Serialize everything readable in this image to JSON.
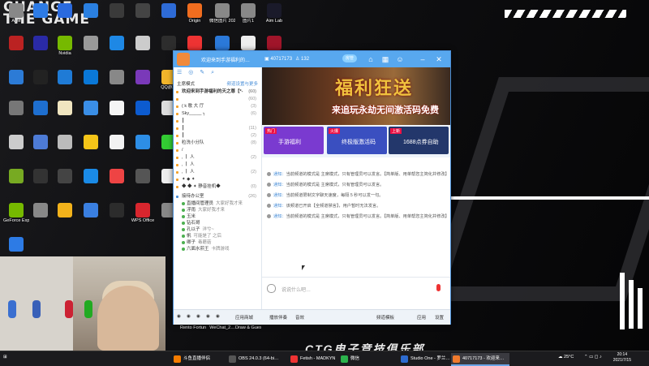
{
  "desktop": {
    "brand_text": "CHANGE THE GAME",
    "brand_bottom": "CTG电子竞技俱乐部",
    "icons": [
      {
        "label": "Ame",
        "color": "#888"
      },
      {
        "label": "",
        "color": "#2d7be5"
      },
      {
        "label": "",
        "color": "#2a6adf"
      },
      {
        "label": "",
        "color": "#2a7fe0"
      },
      {
        "label": "",
        "color": "#3a3a3a"
      },
      {
        "label": "",
        "color": "#444"
      },
      {
        "label": "",
        "color": "#2e6bd6"
      },
      {
        "label": "Origin",
        "color": "#f06d1f"
      },
      {
        "label": "微信图片 2021041…",
        "color": "#888"
      },
      {
        "label": "图片1",
        "color": "#888"
      },
      {
        "label": "Aim Lab",
        "color": "#1a1a2a"
      },
      {
        "label": "",
        "color": "#b22"
      },
      {
        "label": "",
        "color": "#2a2aa6"
      },
      {
        "label": "Nvidia",
        "color": "#76b900"
      },
      {
        "label": "",
        "color": "#999"
      },
      {
        "label": "",
        "color": "#1e88e5"
      },
      {
        "label": "",
        "color": "#ccc"
      },
      {
        "label": "",
        "color": "#2d2d2d"
      },
      {
        "label": "",
        "color": "#e33"
      },
      {
        "label": "",
        "color": "#2b79d9"
      },
      {
        "label": "",
        "color": "#eee"
      },
      {
        "label": "Extreme",
        "color": "#a0152a"
      },
      {
        "label": "",
        "color": "#2c7bd6"
      },
      {
        "label": "",
        "color": "#222"
      },
      {
        "label": "",
        "color": "#1f7bd6"
      },
      {
        "label": "",
        "color": "#0a78d7"
      },
      {
        "label": "",
        "color": "#888"
      },
      {
        "label": "",
        "color": "#7a39b9"
      },
      {
        "label": "QQ游戏",
        "color": "#f2b52b"
      },
      {
        "label": "Microsoft Edge",
        "color": "#1e86d4"
      },
      {
        "label": "",
        "color": "#0a0a0a"
      },
      {
        "label": "",
        "color": "#e6a50a"
      },
      {
        "label": "",
        "color": "#555"
      },
      {
        "label": "",
        "color": "#777"
      },
      {
        "label": "",
        "color": "#1e6fd0"
      },
      {
        "label": "",
        "color": "#f0e5c0"
      },
      {
        "label": "",
        "color": "#3a8ee6"
      },
      {
        "label": "",
        "color": "#f5f5f5"
      },
      {
        "label": "",
        "color": "#0c5bcf"
      },
      {
        "label": "",
        "color": "#ddd"
      },
      {
        "label": "",
        "color": "#e8b420"
      },
      {
        "label": "",
        "color": "#d23"
      },
      {
        "label": "QQ音乐",
        "color": "#31c27c"
      },
      {
        "label": "",
        "color": "#d94b2b"
      },
      {
        "label": "",
        "color": "#ccc"
      },
      {
        "label": "",
        "color": "#4d7bd6"
      },
      {
        "label": "",
        "color": "#bbb"
      },
      {
        "label": "",
        "color": "#f5c518"
      },
      {
        "label": "",
        "color": "#f2f2f2"
      },
      {
        "label": "",
        "color": "#2d8ee6"
      },
      {
        "label": "",
        "color": "#3c3"
      },
      {
        "label": "",
        "color": "#eee"
      },
      {
        "label": "Counter-Strike Global Off…",
        "color": "#e7a72b"
      },
      {
        "label": "",
        "color": "#eee"
      },
      {
        "label": "",
        "color": "#f0f0f0"
      },
      {
        "label": "",
        "color": "#7a2"
      },
      {
        "label": "",
        "color": "#333"
      },
      {
        "label": "",
        "color": "#444"
      },
      {
        "label": "",
        "color": "#1a8ae6"
      },
      {
        "label": "",
        "color": "#e44"
      },
      {
        "label": "",
        "color": "#555"
      },
      {
        "label": "",
        "color": "#eee"
      },
      {
        "label": "",
        "color": "#0f6ad1"
      },
      {
        "label": "CPUID CPU-Z",
        "color": "#4466aa"
      },
      {
        "label": "YY语音",
        "color": "#f4c430"
      },
      {
        "label": "",
        "color": "#888"
      },
      {
        "label": "GeForce Experience",
        "color": "#76b900"
      },
      {
        "label": "",
        "color": "#888"
      },
      {
        "label": "",
        "color": "#f2b21b"
      },
      {
        "label": "",
        "color": "#3a7fe0"
      },
      {
        "label": "",
        "color": "#2c2c2c"
      },
      {
        "label": "WPS Office",
        "color": "#d8262e"
      },
      {
        "label": "",
        "color": "#888"
      },
      {
        "label": "",
        "color": "#888"
      },
      {
        "label": "",
        "color": "#1f8ae6"
      },
      {
        "label": "",
        "color": "#1e78d7"
      },
      {
        "label": "",
        "color": "#fff"
      },
      {
        "label": "",
        "color": "#2d7be5"
      }
    ],
    "dock_labels": [
      "Rento Fortune -…",
      "WeChat_2…",
      "Draw & Guess"
    ]
  },
  "chat_window": {
    "title": "欢迎来到手游福利的…",
    "room_id": "40717173",
    "count": "132",
    "badge": "房管",
    "toolbar_icons": [
      "home-icon",
      "grid-icon",
      "user-icon",
      "min-icon",
      "close-icon"
    ],
    "left": {
      "section_title": "主席模式",
      "section_link": "频道设置与更多",
      "channel_title": "欢迎来到手游福利的天之尊【*-",
      "channel_count": "(60)",
      "rows": [
        {
          "name": "",
          "num": "(60)"
        },
        {
          "name": "( k 歌 大 厅",
          "num": "(3)"
        },
        {
          "name": "Sky_____  ╮",
          "num": "(6)"
        },
        {
          "name": "   ┃",
          "num": ""
        },
        {
          "name": "    ┃",
          "num": "(11)"
        },
        {
          "name": "    ┃",
          "num": "(2)"
        },
        {
          "name": "粒洗小分队",
          "num": "(8)"
        },
        {
          "name": "        /",
          "num": ""
        },
        {
          "name": "      ,  ┃  人",
          "num": "(2)"
        },
        {
          "name": "     ,  ┃  人",
          "num": ""
        },
        {
          "name": "    ,  ┃  人",
          "num": "(2)"
        },
        {
          "name": "  ✦  ◆  ✦",
          "num": ""
        },
        {
          "name": "  ◆  ◆  ✦  静音挂机◆",
          "num": "(0)"
        }
      ],
      "sub_title": "接待办公室",
      "sub_num": "(26)",
      "members": [
        {
          "name": "直播间管理员",
          "tag": "大家好我才来"
        },
        {
          "name": "浮雨",
          "tag": "大家好我才来"
        },
        {
          "name": "玉米",
          "tag": ""
        },
        {
          "name": "钻石哥",
          "tag": ""
        },
        {
          "name": "孔以子",
          "tag": "洋兮~"
        },
        {
          "name": "帆",
          "tag": "可能是了 之后"
        },
        {
          "name": "卿子",
          "tag": "毒蘑菇"
        },
        {
          "name": "六面水煎王",
          "tag": "卡牌游戏"
        }
      ]
    },
    "banner": {
      "headline": "福利狂送",
      "subline": "来追玩永劫无间激活码免费"
    },
    "promos": [
      {
        "tag": "热门",
        "title": "手游福利",
        "color": "#7a3ad0"
      },
      {
        "tag": "火爆",
        "title": "终极版激活码",
        "color": "#3a4fc0"
      },
      {
        "tag": "上新",
        "title": "1688点券自助",
        "color": "#23376b"
      }
    ],
    "messages": [
      {
        "prefix": "通知：",
        "text": "当前频道的模式是 主席模式，只有管理员可以发言。【简单版、用单帮您主简化并修改】"
      },
      {
        "prefix": "通知：",
        "text": "当前频道的模式是 主席模式，只有管理员可以发言。"
      },
      {
        "prefix": "通知：",
        "text": "当前频道限制文字聊天速度，每隔 5 秒可以发一句。"
      },
      {
        "prefix": "通知：",
        "text": "该频道已开启【全频道禁言】，用户暂时无法发言。"
      },
      {
        "prefix": "通知：",
        "text": "当前频道的模式是 主席模式，只有管理员可以发言。【简单版、用单帮您主简化并修改】"
      }
    ],
    "input_placeholder": "说说什么吧…",
    "bottom_items": [
      "",
      "",
      "",
      "",
      "",
      "应用商城",
      "播放伴奏",
      "音效",
      "频道模板",
      "应用",
      "设置"
    ]
  },
  "taskbar": {
    "tasks": [
      {
        "label": "斗鱼直播伴侣",
        "color": "#f57c00",
        "active": false
      },
      {
        "label": "OBS 24.0.3 (64-bi…",
        "color": "#555",
        "active": false
      },
      {
        "label": "Fetish - MADKYN",
        "color": "#e33",
        "active": false
      },
      {
        "label": "微信",
        "color": "#2bb24c",
        "active": false
      },
      {
        "label": "Studio One - 罗兰…",
        "color": "#2d6bcf",
        "active": false
      },
      {
        "label": "40717173 - 欢迎来…",
        "color": "#f07a2d",
        "active": true
      }
    ],
    "weather": "25°C",
    "time": "20:14",
    "date": "2021/7/15"
  }
}
